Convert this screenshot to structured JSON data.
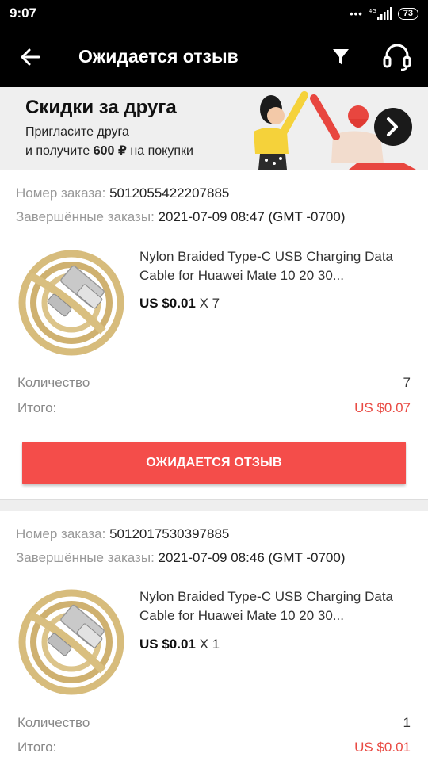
{
  "status": {
    "time": "9:07",
    "network": "4G",
    "battery": "73"
  },
  "header": {
    "title": "Ожидается отзыв"
  },
  "banner": {
    "title": "Скидки за друга",
    "line1": "Пригласите друга",
    "line2_prefix": "и получите ",
    "line2_amount": "600 ₽",
    "line2_suffix": " на покупки"
  },
  "labels": {
    "order_number": "Номер заказа:",
    "completed": "Завершённые заказы:",
    "quantity": "Количество",
    "total": "Итого:"
  },
  "orders": [
    {
      "number": "5012055422207885",
      "date": "2021-07-09 08:47 (GMT -0700)",
      "product_title": "Nylon Braided Type-C USB Charging Data Cable for Huawei Mate 10 20 30...",
      "price": "US $0.01",
      "qty_suffix": "X 7",
      "quantity": "7",
      "total": "US $0.07",
      "button": "ОЖИДАЕТСЯ ОТЗЫВ"
    },
    {
      "number": "5012017530397885",
      "date": "2021-07-09 08:46 (GMT -0700)",
      "product_title": "Nylon Braided Type-C USB Charging Data Cable for Huawei Mate 10 20 30...",
      "price": "US $0.01",
      "qty_suffix": "X 1",
      "quantity": "1",
      "total": "US $0.01"
    }
  ],
  "icons": {
    "back": "arrow-left-icon",
    "filter": "filter-icon",
    "support": "headset-icon"
  }
}
